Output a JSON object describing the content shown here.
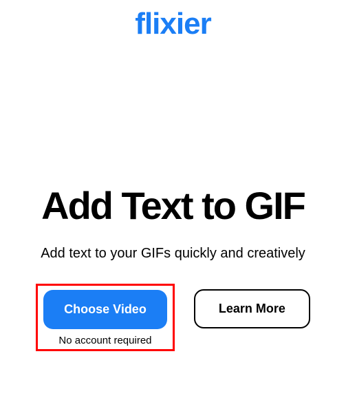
{
  "logo": {
    "text": "flixier"
  },
  "hero": {
    "title": "Add Text to GIF",
    "subtitle": "Add text to your GIFs quickly and creatively"
  },
  "cta": {
    "primary": "Choose Video",
    "no_account": "No account required",
    "secondary": "Learn More"
  }
}
